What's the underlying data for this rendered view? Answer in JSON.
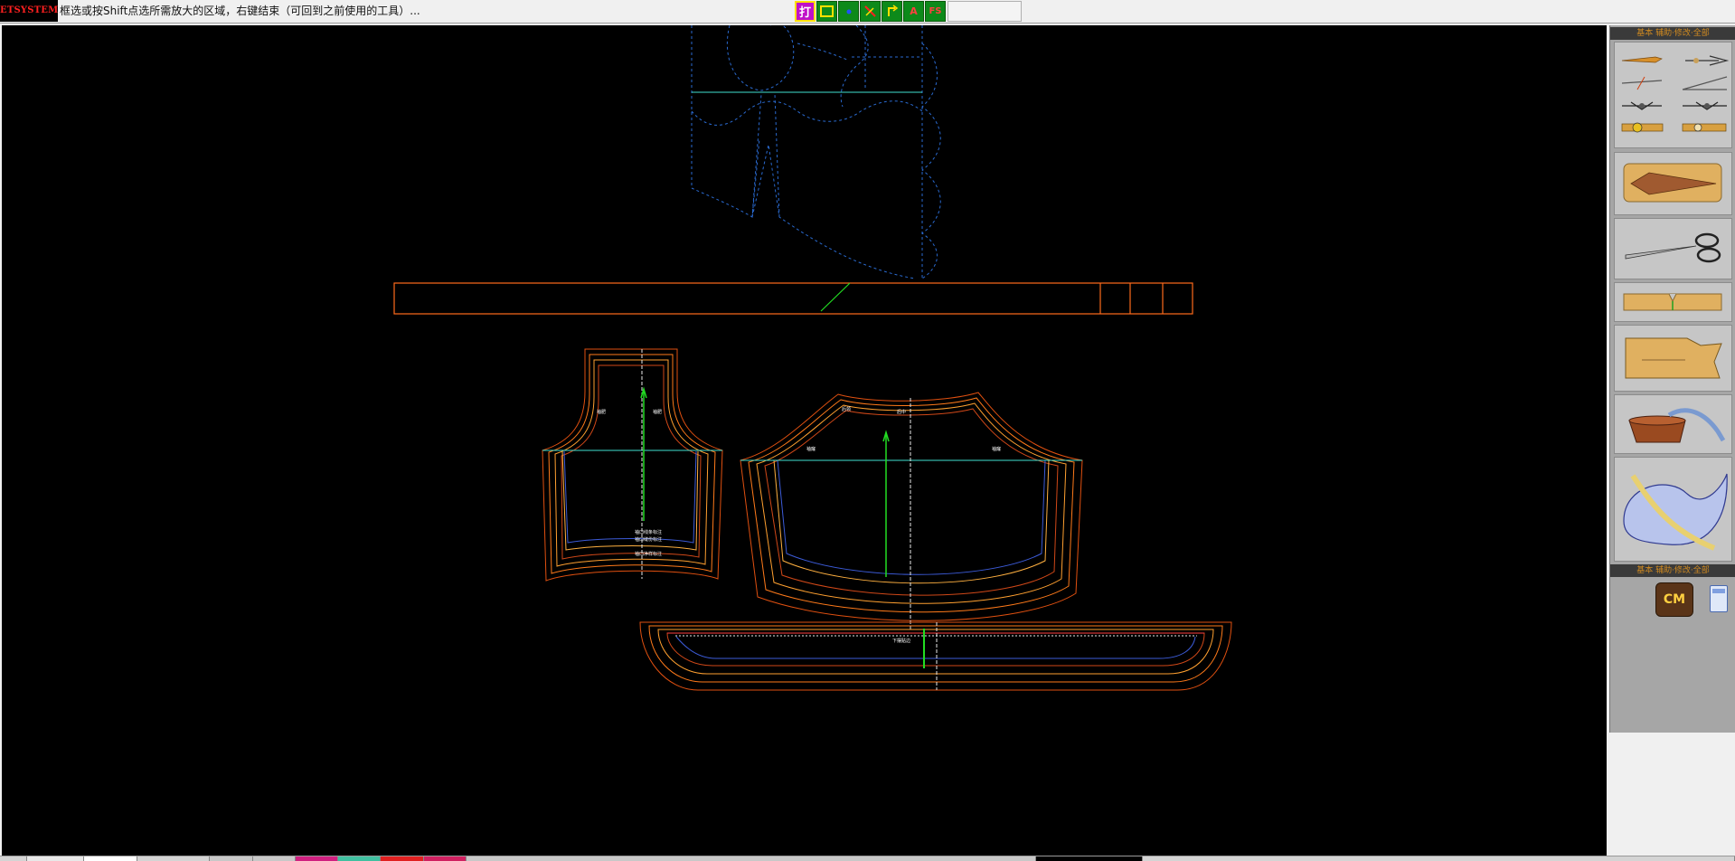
{
  "app": {
    "brand": "ETSYSTEM",
    "status_hint": "框选或按Shift点选所需放大的区域，右键结束（可回到之前使用的工具）..."
  },
  "toolbar": {
    "items": [
      {
        "name": "print-tool",
        "glyph": "打",
        "active": true
      },
      {
        "name": "rect-tool",
        "glyph": "▭"
      },
      {
        "name": "point-tool",
        "glyph": "•"
      },
      {
        "name": "cross-tool",
        "glyph": "✕"
      },
      {
        "name": "arrow-tool",
        "glyph": "↰"
      },
      {
        "name": "text-tool",
        "glyph": "A"
      },
      {
        "name": "fs-tool",
        "glyph": "FS"
      }
    ]
  },
  "panel": {
    "section1_title": "基本   辅助·修改·全部",
    "section2_title": "基本   辅助·修改·全部",
    "unit_label": "CM",
    "tools": [
      "pencil-icon",
      "pen-nib-icon",
      "line-icon",
      "angle-icon",
      "compass-icon",
      "compass2-icon",
      "tape-icon",
      "tape2-icon",
      "cutting-knife-icon",
      "scissors-icon",
      "notch-icon",
      "pattern-piece-icon",
      "basin-icon",
      "french-curve-icon",
      "calculator-icon"
    ]
  },
  "colors": {
    "canvas_bg": "#000000",
    "seam_orange": "#ff7a1a",
    "seam_dark": "#e05010",
    "blue": "#3c5bd8",
    "dashed_blue": "#2a6ad0",
    "grain_green": "#22dd22",
    "cyan": "#40e0d0",
    "active_tool": "#c010c8"
  },
  "piece_labels": {
    "sleeve_a": "袖肥",
    "sleeve_b": "袖肥",
    "sleeve_c1": "袖口线条标注",
    "sleeve_c2": "袖口缝份标注",
    "sleeve_c3": "袖口净样标注",
    "back_a": "后领",
    "back_b": "袖窿",
    "back_c": "袖窿",
    "back_d": "后中",
    "hem": "下摆贴边"
  }
}
